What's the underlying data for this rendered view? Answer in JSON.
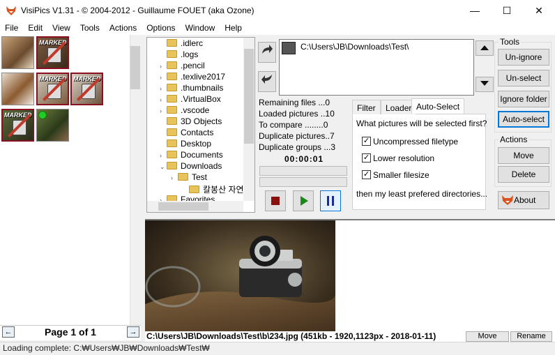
{
  "window": {
    "title": "VisiPics V1.31 - © 2004-2012 - Guillaume FOUET (aka Ozone)",
    "minimize": "—",
    "maximize": "☐",
    "close": "✕"
  },
  "menu": [
    "File",
    "Edit",
    "View",
    "Tools",
    "Actions",
    "Options",
    "Window",
    "Help"
  ],
  "thumbnails": {
    "marked_label": "MARKED",
    "page_label": "Page 1 of 1",
    "prev_icon": "←",
    "next_icon": "→"
  },
  "tree": {
    "items": [
      {
        "label": ".idlerc",
        "expander": ""
      },
      {
        "label": ".logs",
        "expander": ""
      },
      {
        "label": ".pencil",
        "expander": "›"
      },
      {
        "label": ".texlive2017",
        "expander": "›"
      },
      {
        "label": ".thumbnails",
        "expander": "›"
      },
      {
        "label": ".VirtualBox",
        "expander": "›"
      },
      {
        "label": ".vscode",
        "expander": "›"
      },
      {
        "label": "3D Objects",
        "expander": ""
      },
      {
        "label": "Contacts",
        "expander": ""
      },
      {
        "label": "Desktop",
        "expander": ""
      },
      {
        "label": "Documents",
        "expander": "›"
      },
      {
        "label": "Downloads",
        "expander": "⌄"
      },
      {
        "label": "Test",
        "expander": "›"
      },
      {
        "label": "칼봉산 자연",
        "expander": ""
      },
      {
        "label": "Favorites",
        "expander": "›"
      }
    ]
  },
  "dirlist": {
    "item": "C:\\Users\\JB\\Downloads\\Test\\"
  },
  "stats": {
    "remaining": "Remaining files ...0",
    "loaded": "Loaded pictures ..10",
    "to_compare": "To compare ........0",
    "dup_pictures": "Duplicate pictures..7",
    "dup_groups": "Duplicate groups ...3",
    "timer": "00:00:01"
  },
  "tabs": {
    "labels": [
      "Filter",
      "Loader",
      "Auto-Select"
    ],
    "question": "What pictures will be selected first?",
    "options": [
      {
        "label": "Uncompressed filetype",
        "checked": true
      },
      {
        "label": "Lower resolution",
        "checked": true
      },
      {
        "label": "Smaller filesize",
        "checked": true
      }
    ],
    "footer": "then my least prefered directories..."
  },
  "tools": {
    "group_label": "Tools",
    "buttons": [
      "Un-ignore",
      "Un-select",
      "Ignore folder",
      "Auto-select"
    ]
  },
  "actions": {
    "group_label": "Actions",
    "buttons": [
      "Move",
      "Delete"
    ]
  },
  "about_label": "About",
  "preview": {
    "info": "C:\\Users\\JB\\Downloads\\Test\\b\\234.jpg (451kb - 1920,1123px - 2018-01-11)",
    "move_label": "Move",
    "rename_label": "Rename"
  },
  "status": "Loading complete: C:₩Users₩JB₩Downloads₩Test₩",
  "colors": {
    "marked_border": "#8a1020",
    "accent": "#0078d7"
  }
}
